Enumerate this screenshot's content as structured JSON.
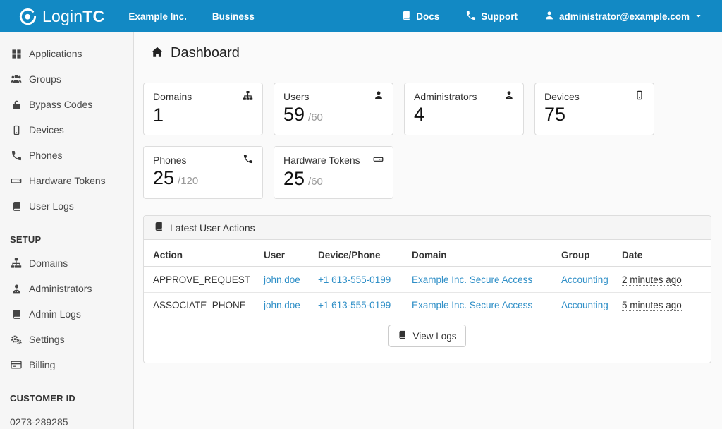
{
  "colors": {
    "topbar_blue": "#1289c4",
    "link_blue": "#2f8fc7",
    "sidebar_bg": "#f6f6f6"
  },
  "topbar": {
    "logo": {
      "text_light": "Login",
      "text_bold": "TC"
    },
    "nav_left": [
      {
        "label": "Example Inc."
      },
      {
        "label": "Business"
      }
    ],
    "docs_label": "Docs",
    "support_label": "Support",
    "account_email": "administrator@example.com"
  },
  "sidebar": {
    "items": [
      {
        "label": "Applications",
        "icon": "grid-icon"
      },
      {
        "label": "Groups",
        "icon": "users-icon"
      },
      {
        "label": "Bypass Codes",
        "icon": "unlock-icon"
      },
      {
        "label": "Devices",
        "icon": "mobile-icon"
      },
      {
        "label": "Phones",
        "icon": "phone-icon"
      },
      {
        "label": "Hardware Tokens",
        "icon": "hdd-icon"
      },
      {
        "label": "User Logs",
        "icon": "book-icon"
      }
    ],
    "setup_header": "SETUP",
    "setup_items": [
      {
        "label": "Domains",
        "icon": "sitemap-icon"
      },
      {
        "label": "Administrators",
        "icon": "admin-user-icon"
      },
      {
        "label": "Admin Logs",
        "icon": "book-icon"
      },
      {
        "label": "Settings",
        "icon": "gears-icon"
      },
      {
        "label": "Billing",
        "icon": "credit-card-icon"
      }
    ],
    "customer_id_header": "CUSTOMER ID",
    "customer_id": "0273-289285"
  },
  "main": {
    "page_title": "Dashboard",
    "stat_cards": [
      {
        "title": "Domains",
        "value": "1",
        "limit": "",
        "icon": "sitemap-icon"
      },
      {
        "title": "Users",
        "value": "59",
        "limit": "/60",
        "icon": "user-icon"
      },
      {
        "title": "Administrators",
        "value": "4",
        "limit": "",
        "icon": "admin-user-icon"
      },
      {
        "title": "Devices",
        "value": "75",
        "limit": "",
        "icon": "mobile-icon"
      },
      {
        "title": "Phones",
        "value": "25",
        "limit": "/120",
        "icon": "phone-icon"
      },
      {
        "title": "Hardware Tokens",
        "value": "25",
        "limit": "/60",
        "icon": "hdd-icon"
      }
    ],
    "panel": {
      "title": "Latest User Actions",
      "columns": [
        "Action",
        "User",
        "Device/Phone",
        "Domain",
        "Group",
        "Date"
      ],
      "rows": [
        {
          "action": "APPROVE_REQUEST",
          "user": "john.doe",
          "device_phone": "+1 613-555-0199",
          "domain": "Example Inc. Secure Access",
          "group": "Accounting",
          "date": "2 minutes ago"
        },
        {
          "action": "ASSOCIATE_PHONE",
          "user": "john.doe",
          "device_phone": "+1 613-555-0199",
          "domain": "Example Inc. Secure Access",
          "group": "Accounting",
          "date": "5 minutes ago"
        }
      ],
      "view_logs_label": "View Logs"
    }
  }
}
